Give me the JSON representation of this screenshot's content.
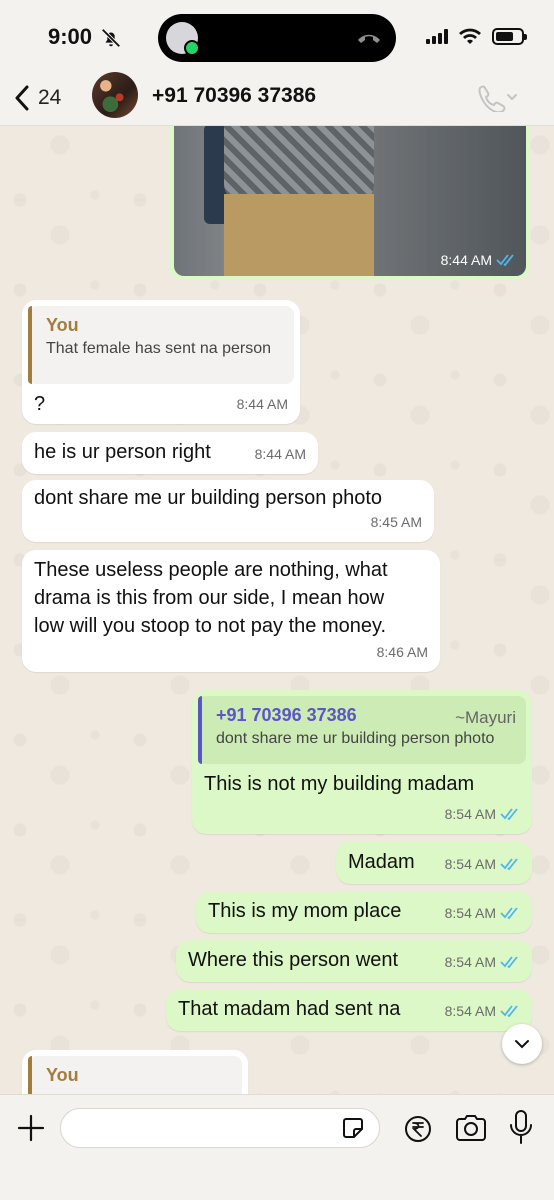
{
  "status_bar": {
    "time": "9:00"
  },
  "header": {
    "back_count": "24",
    "contact_name": "+91 70396 37386"
  },
  "messages": [
    {
      "id": "image-msg",
      "direction": "out",
      "type": "image",
      "time": "8:44 AM"
    },
    {
      "id": "msg-1",
      "direction": "in",
      "quote_author": "You",
      "quote_text": "That female has sent na person",
      "text": "?",
      "time": "8:44 AM"
    },
    {
      "id": "msg-2",
      "direction": "in",
      "text": "he is ur person right",
      "time": "8:44 AM"
    },
    {
      "id": "msg-3",
      "direction": "in",
      "text": "dont share me ur building person photo",
      "time": "8:45 AM"
    },
    {
      "id": "msg-4",
      "direction": "in",
      "text_lines": [
        "These useless people are nothing, what",
        "drama is this from our side, I mean how",
        "low will you stoop to not pay the money."
      ],
      "time": "8:46 AM"
    },
    {
      "id": "msg-5",
      "direction": "out",
      "quote_author": "+91 70396 37386",
      "quote_alias": "~Mayuri",
      "quote_text": "dont share me ur building person photo",
      "text": "This is not my building madam",
      "time": "8:54 AM"
    },
    {
      "id": "msg-6",
      "direction": "out",
      "text": "Madam",
      "time": "8:54 AM"
    },
    {
      "id": "msg-7",
      "direction": "out",
      "text": "This is my mom place",
      "time": "8:54 AM"
    },
    {
      "id": "msg-8",
      "direction": "out",
      "text": "Where this person went",
      "time": "8:54 AM"
    },
    {
      "id": "msg-9",
      "direction": "out",
      "text": "That madam had sent na",
      "time": "8:54 AM"
    },
    {
      "id": "msg-10",
      "direction": "in",
      "quote_author": "You"
    }
  ],
  "input": {
    "placeholder": ""
  },
  "colors": {
    "outgoing_bubble": "#dbf8c6",
    "incoming_bubble": "#ffffff",
    "read_ticks": "#4fb6ec",
    "quote_self": "#a37d3e",
    "quote_other": "#5b55c9"
  },
  "icons": [
    "bell-off-icon",
    "call-avatar-icon",
    "hangup-icon",
    "signal-icon",
    "wifi-icon",
    "battery-icon",
    "back-chevron-icon",
    "phone-icon",
    "chevron-down-icon",
    "plus-icon",
    "sticker-icon",
    "rupee-icon",
    "camera-icon",
    "mic-icon",
    "read-ticks-icon"
  ]
}
